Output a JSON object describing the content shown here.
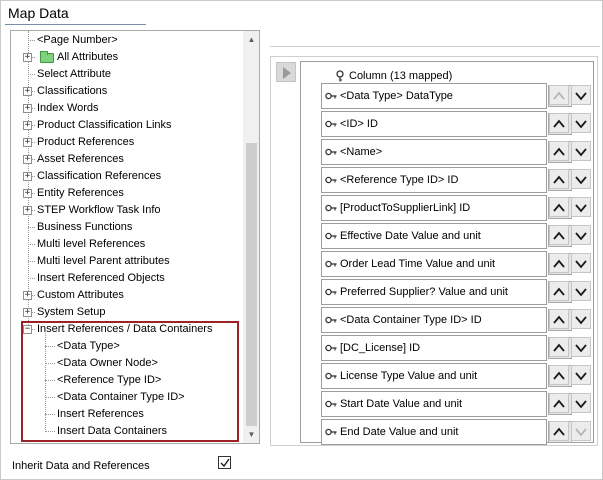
{
  "title": "Map Data",
  "tree": {
    "items": [
      {
        "label": "<Page Number>",
        "level": 1,
        "expander": "none"
      },
      {
        "label": "All Attributes",
        "level": 1,
        "expander": "plus",
        "icon": "folder-icon"
      },
      {
        "label": "Select Attribute",
        "level": 1,
        "expander": "none"
      },
      {
        "label": "Classifications",
        "level": 1,
        "expander": "plus"
      },
      {
        "label": "Index Words",
        "level": 1,
        "expander": "plus"
      },
      {
        "label": "Product Classification Links",
        "level": 1,
        "expander": "plus"
      },
      {
        "label": "Product References",
        "level": 1,
        "expander": "plus"
      },
      {
        "label": "Asset References",
        "level": 1,
        "expander": "plus"
      },
      {
        "label": "Classification References",
        "level": 1,
        "expander": "plus"
      },
      {
        "label": "Entity References",
        "level": 1,
        "expander": "plus"
      },
      {
        "label": "STEP Workflow Task Info",
        "level": 1,
        "expander": "plus"
      },
      {
        "label": "Business Functions",
        "level": 1,
        "expander": "none"
      },
      {
        "label": "Multi level References",
        "level": 1,
        "expander": "none"
      },
      {
        "label": "Multi level Parent attributes",
        "level": 1,
        "expander": "none"
      },
      {
        "label": "Insert Referenced Objects",
        "level": 1,
        "expander": "none"
      },
      {
        "label": "Custom Attributes",
        "level": 1,
        "expander": "plus"
      },
      {
        "label": "System Setup",
        "level": 1,
        "expander": "plus"
      },
      {
        "label": "Insert References / Data Containers",
        "level": 1,
        "expander": "minus"
      },
      {
        "label": "<Data Type>",
        "level": 2,
        "expander": "none"
      },
      {
        "label": "<Data Owner Node>",
        "level": 2,
        "expander": "none"
      },
      {
        "label": "<Reference Type ID>",
        "level": 2,
        "expander": "none"
      },
      {
        "label": "<Data Container Type ID>",
        "level": 2,
        "expander": "none"
      },
      {
        "label": "Insert References",
        "level": 2,
        "expander": "none"
      },
      {
        "label": "Insert Data Containers",
        "level": 2,
        "expander": "none"
      }
    ]
  },
  "column": {
    "header": "Column (13 mapped)",
    "rows": [
      {
        "label": "<Data Type> DataType",
        "up_enabled": false,
        "down_enabled": true
      },
      {
        "label": "<ID> ID",
        "up_enabled": true,
        "down_enabled": true
      },
      {
        "label": "<Name>",
        "up_enabled": true,
        "down_enabled": true
      },
      {
        "label": "<Reference Type ID> ID",
        "up_enabled": true,
        "down_enabled": true
      },
      {
        "label": "[ProductToSupplierLink] ID",
        "up_enabled": true,
        "down_enabled": true
      },
      {
        "label": "Effective Date Value and unit",
        "up_enabled": true,
        "down_enabled": true
      },
      {
        "label": "Order Lead Time Value and unit",
        "up_enabled": true,
        "down_enabled": true
      },
      {
        "label": "Preferred Supplier? Value and unit",
        "up_enabled": true,
        "down_enabled": true
      },
      {
        "label": "<Data Container Type ID> ID",
        "up_enabled": true,
        "down_enabled": true
      },
      {
        "label": "[DC_License] ID",
        "up_enabled": true,
        "down_enabled": true
      },
      {
        "label": "License Type Value and unit",
        "up_enabled": true,
        "down_enabled": true
      },
      {
        "label": "Start Date Value and unit",
        "up_enabled": true,
        "down_enabled": true
      },
      {
        "label": "End Date Value and unit",
        "up_enabled": true,
        "down_enabled": false
      }
    ]
  },
  "inherit": {
    "label": "Inherit Data and References",
    "checked": true
  },
  "colors": {
    "highlight": "#9b2226",
    "arrow_enabled": "#1a1a1a",
    "arrow_disabled": "#b5b5b5"
  }
}
